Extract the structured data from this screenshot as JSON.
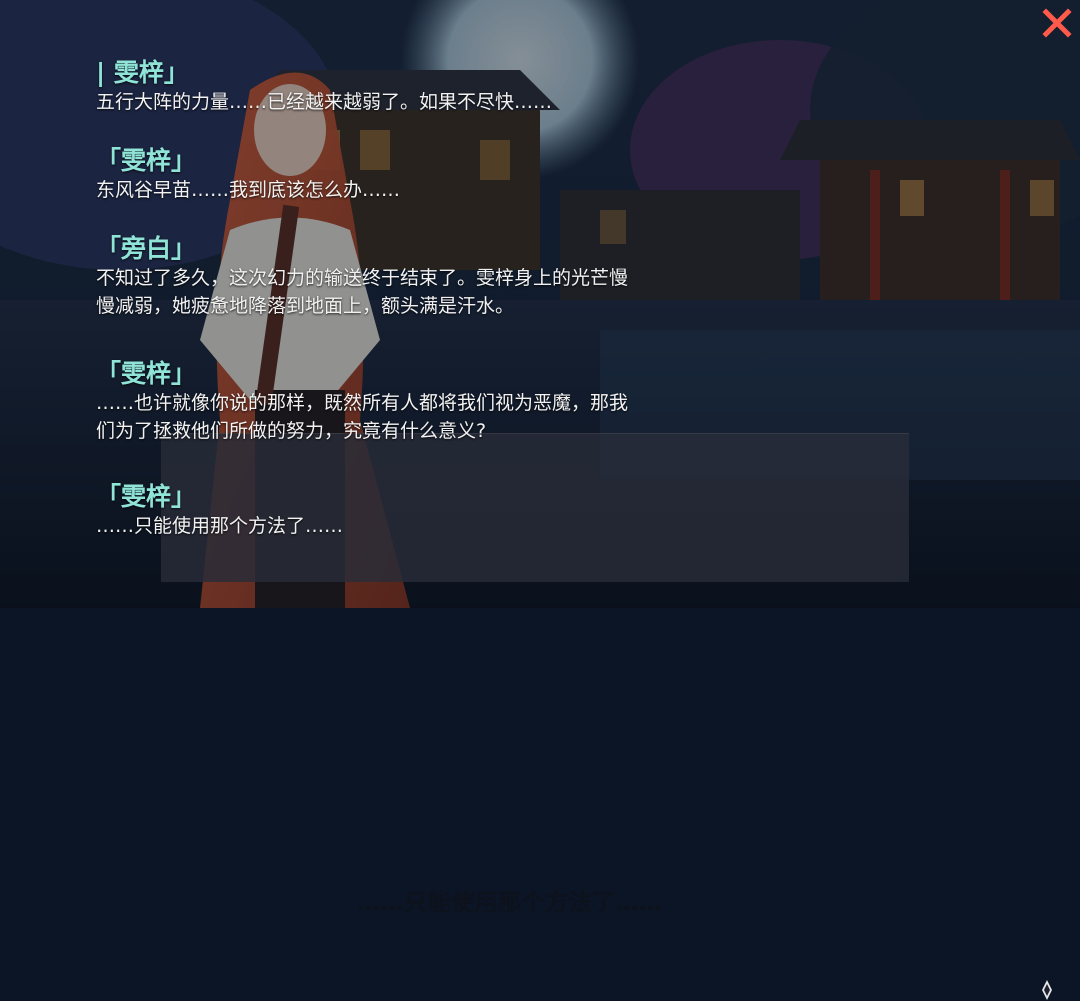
{
  "close_icon": "close-x-icon",
  "accent_color": "#ff5a4a",
  "speaker_color": "#8fe4d7",
  "log": [
    {
      "speaker": "| 雯梓」",
      "lines": [
        "五行大阵的力量……已经越来越弱了。如果不尽快……"
      ]
    },
    {
      "speaker": "「雯梓」",
      "lines": [
        "东风谷早苗……我到底该怎么办……"
      ]
    },
    {
      "speaker": "「旁白」",
      "lines": [
        "不知过了多久，这次幻力的输送终于结束了。雯梓身上的光芒慢",
        "慢减弱，她疲惫地降落到地面上，额头满是汗水。"
      ]
    },
    {
      "speaker": "「雯梓」",
      "lines": [
        "……也许就像你说的那样，既然所有人都将我们视为恶魔，那我",
        "们为了拯救他们所做的努力，究竟有什么意义?"
      ]
    },
    {
      "speaker": "「雯梓」",
      "lines": [
        "……只能使用那个方法了……"
      ]
    }
  ],
  "dialog_box": {
    "text": "……只能使用那个方法了……",
    "advance_icon": "diamond-arrow-icon"
  }
}
